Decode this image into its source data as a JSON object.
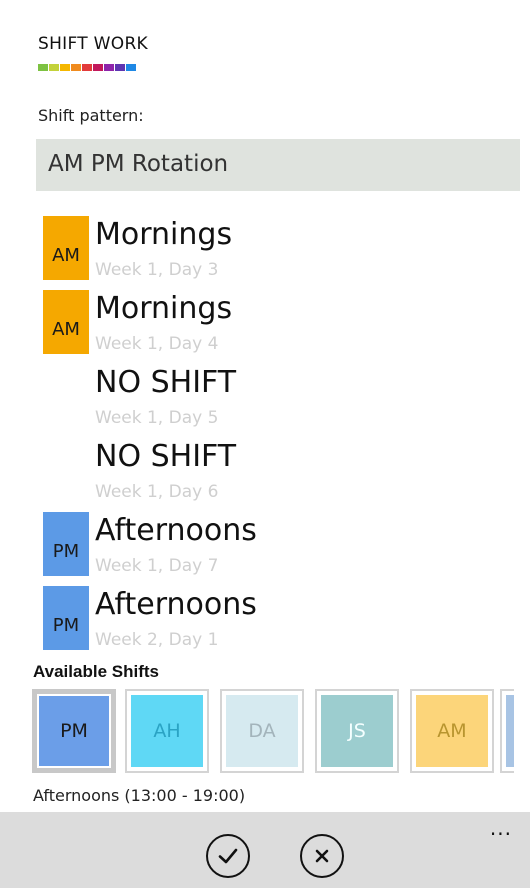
{
  "app": {
    "title": "SHIFT WORK",
    "brand_colors": [
      "#7dc242",
      "#c3d23a",
      "#f5b700",
      "#f08b1e",
      "#e23b3b",
      "#c2185b",
      "#8e24aa",
      "#5e35b1",
      "#1e88e5"
    ]
  },
  "pattern": {
    "label": "Shift pattern:",
    "value": "AM PM Rotation",
    "background": "#dfe3de"
  },
  "shifts": [
    {
      "code": "AM",
      "name": "Mornings",
      "day": "Week 1, Day 3",
      "color": "#f5a800"
    },
    {
      "code": "AM",
      "name": "Mornings",
      "day": "Week 1, Day 4",
      "color": "#f5a800"
    },
    {
      "code": "",
      "name": "NO SHIFT",
      "day": "Week 1, Day 5",
      "color": ""
    },
    {
      "code": "",
      "name": "NO SHIFT",
      "day": "Week 1, Day 6",
      "color": ""
    },
    {
      "code": "PM",
      "name": "Afternoons",
      "day": "Week 1, Day 7",
      "color": "#5c9ae6"
    },
    {
      "code": "PM",
      "name": "Afternoons",
      "day": "Week 2, Day 1",
      "color": "#5c9ae6"
    }
  ],
  "available": {
    "title": "Available Shifts",
    "tiles": [
      {
        "code": "PM",
        "color": "#6b9ee8",
        "text_color": "#1a1a1a",
        "selected": true
      },
      {
        "code": "AH",
        "color": "#5fd8f5",
        "text_color": "#2aa3c4",
        "selected": false
      },
      {
        "code": "DA",
        "color": "#d6eaf0",
        "text_color": "#a3b4bb",
        "selected": false
      },
      {
        "code": "JS",
        "color": "#9ccdcf",
        "text_color": "#f4ffff",
        "selected": false
      },
      {
        "code": "AM",
        "color": "#fcd57a",
        "text_color": "#b8952f",
        "selected": false
      },
      {
        "code": "",
        "color": "#a8c4e4",
        "text_color": "#ffffff",
        "selected": false
      }
    ],
    "selected_description": "Afternoons (13:00 - 19:00)"
  },
  "app_bar": {
    "accept_icon": "check-icon",
    "cancel_icon": "close-icon",
    "more": "..."
  }
}
